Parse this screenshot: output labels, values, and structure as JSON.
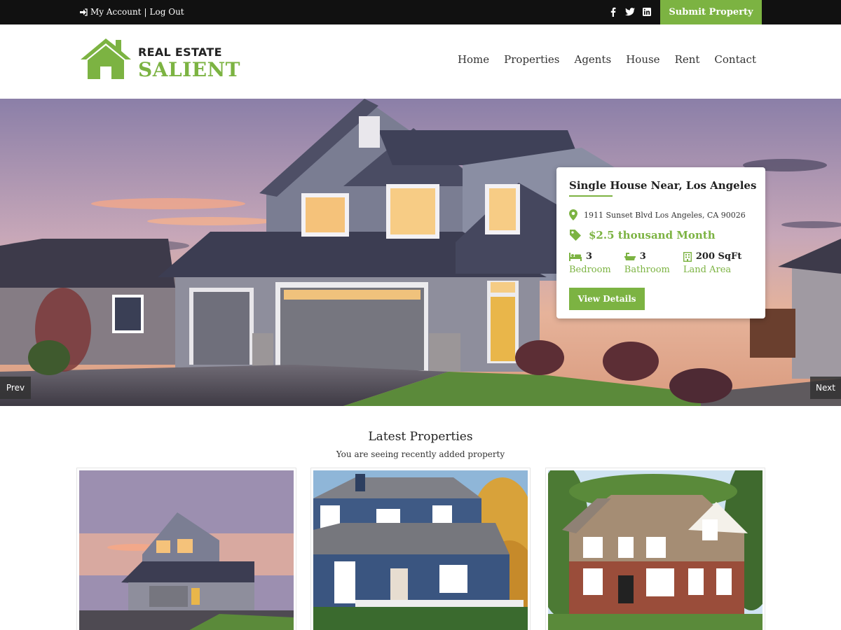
{
  "topbar": {
    "account_label": "My Account",
    "separator": "|",
    "logout_label": "Log Out",
    "socials": [
      "facebook-icon",
      "twitter-icon",
      "linkedin-icon"
    ],
    "submit_label": "Submit Property"
  },
  "header": {
    "logo_line1": "REAL ESTATE",
    "logo_line2": "SALIENT",
    "nav": [
      "Home",
      "Properties",
      "Agents",
      "House",
      "Rent",
      "Contact"
    ]
  },
  "hero": {
    "prev_label": "Prev",
    "next_label": "Next",
    "card": {
      "title": "Single House Near, Los Angeles",
      "address": "1911 Sunset Blvd Los Angeles, CA 90026",
      "price": "$2.5 thousand Month",
      "features": [
        {
          "icon": "bed-icon",
          "value": "3",
          "label": "Bedroom"
        },
        {
          "icon": "bath-icon",
          "value": "3",
          "label": "Bathroom"
        },
        {
          "icon": "building-icon",
          "value": "200 SqFt",
          "label": "Land Area"
        }
      ],
      "button_label": "View Details"
    }
  },
  "latest": {
    "title": "Latest Properties",
    "subtitle": "You are seeing recently added property"
  },
  "colors": {
    "accent": "#7cb342",
    "topbar_bg": "#111111"
  }
}
